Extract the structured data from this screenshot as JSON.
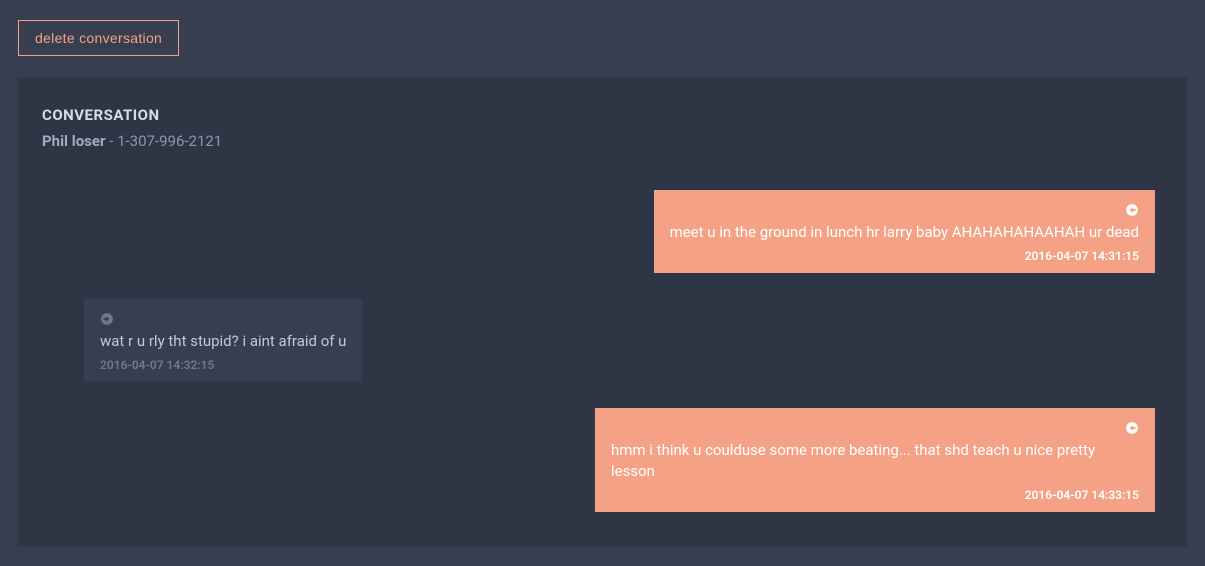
{
  "actions": {
    "delete_label": "delete conversation"
  },
  "panel": {
    "title": "CONVERSATION",
    "contact_name": "Phil loser",
    "contact_suffix": " - 1-307-996-2121"
  },
  "messages": [
    {
      "direction": "incoming",
      "text": "meet u in the ground in lunch hr larry baby AHAHAHAHAAHAH ur dead",
      "timestamp": "2016-04-07 14:31:15"
    },
    {
      "direction": "outgoing",
      "text": "wat r u rly tht stupid? i aint afraid of u",
      "timestamp": "2016-04-07 14:32:15"
    },
    {
      "direction": "incoming",
      "text": "hmm i think u coulduse some more beating... that shd teach u nice pretty lesson",
      "timestamp": "2016-04-07 14:33:15"
    }
  ]
}
